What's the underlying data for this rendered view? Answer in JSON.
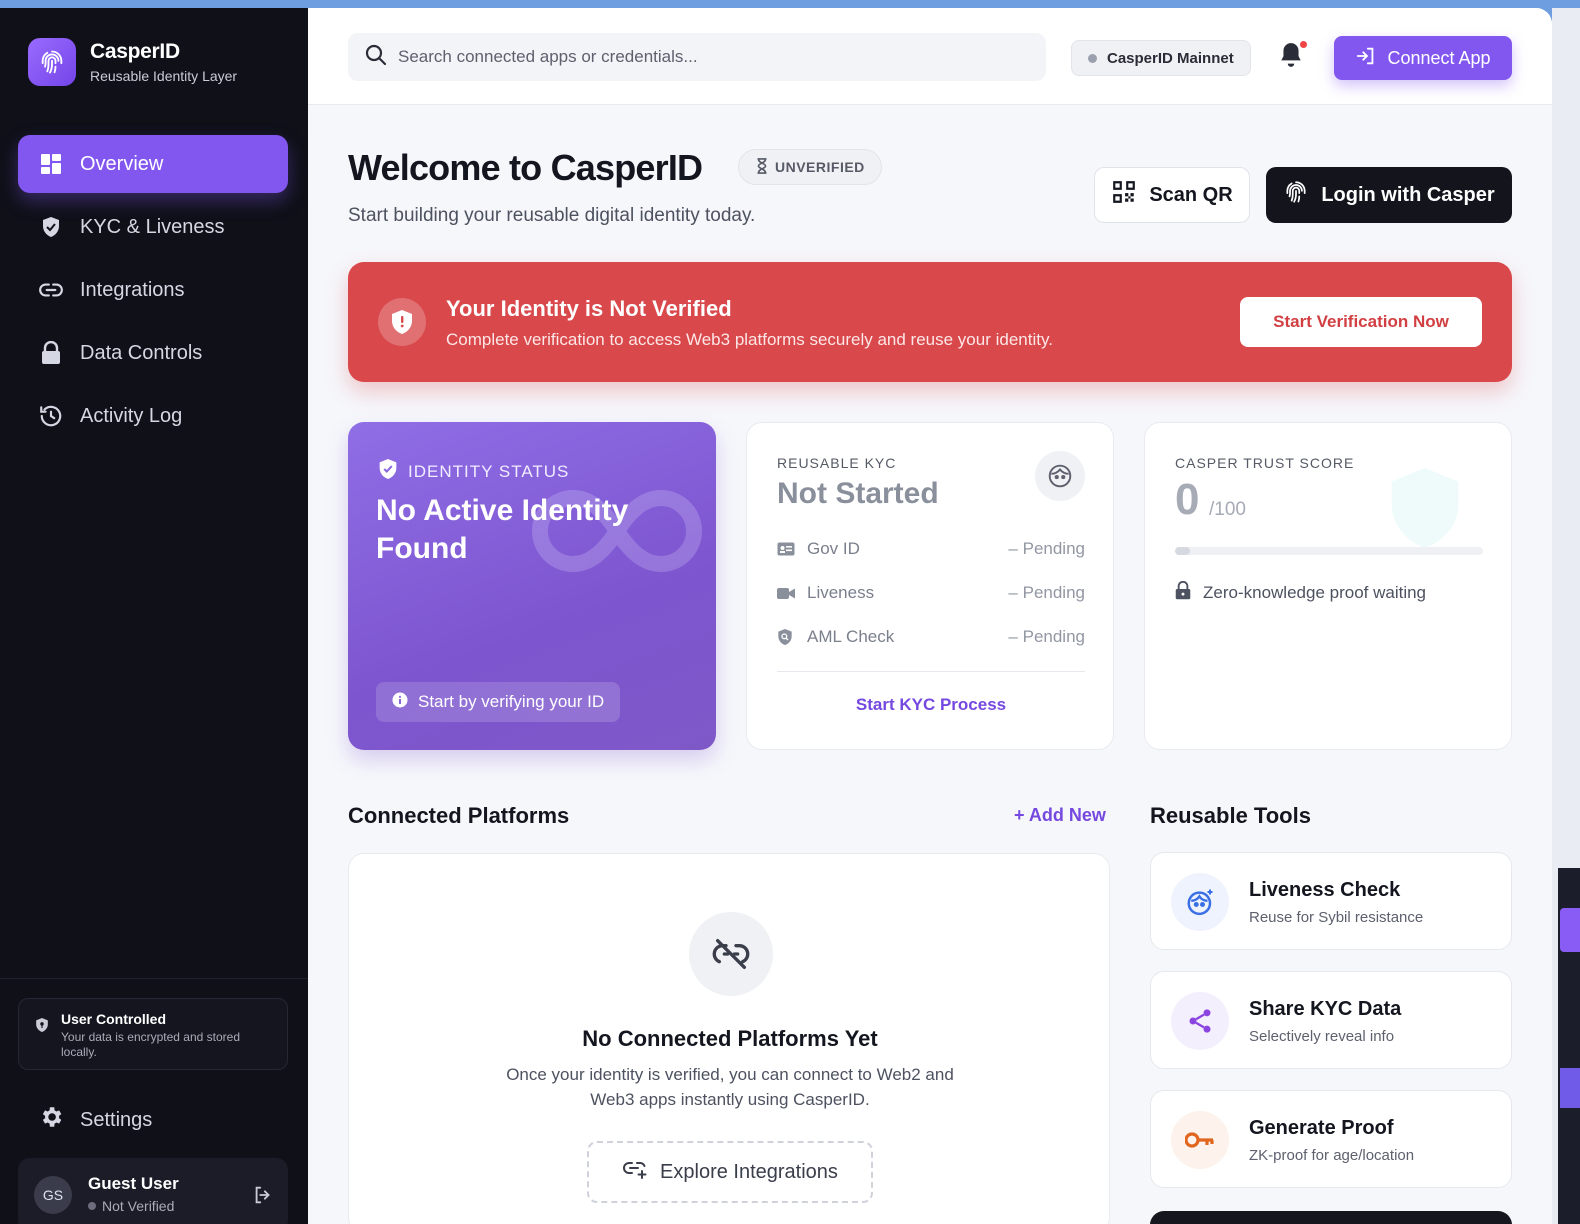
{
  "brand": {
    "name": "CasperID",
    "tagline": "Reusable Identity Layer"
  },
  "nav": [
    {
      "label": "Overview",
      "icon": "dashboard-icon",
      "active": true
    },
    {
      "label": "KYC & Liveness",
      "icon": "shield-icon",
      "active": false
    },
    {
      "label": "Integrations",
      "icon": "link-icon",
      "active": false
    },
    {
      "label": "Data Controls",
      "icon": "lock-icon",
      "active": false
    },
    {
      "label": "Activity Log",
      "icon": "history-icon",
      "active": false
    }
  ],
  "privacy": {
    "title": "User Controlled",
    "subtitle": "Your data is encrypted and stored locally."
  },
  "settings_label": "Settings",
  "user": {
    "initials": "GS",
    "name": "Guest User",
    "status": "Not Verified"
  },
  "topbar": {
    "search_placeholder": "Search connected apps or credentials...",
    "network": "CasperID Mainnet",
    "connect_label": "Connect App"
  },
  "header": {
    "title": "Welcome to CasperID",
    "badge": "UNVERIFIED",
    "subtitle": "Start building your reusable digital identity today.",
    "scan_label": "Scan QR",
    "login_label": "Login with Casper"
  },
  "alert": {
    "title": "Your Identity is Not Verified",
    "subtitle": "Complete verification to access Web3 platforms securely and reuse your identity.",
    "button": "Start Verification Now"
  },
  "identity_card": {
    "label": "IDENTITY STATUS",
    "title": "No Active Identity Found",
    "hint": "Start by verifying your ID"
  },
  "kyc_card": {
    "label": "REUSABLE KYC",
    "status": "Not Started",
    "rows": [
      {
        "label": "Gov ID",
        "value": "– Pending"
      },
      {
        "label": "Liveness",
        "value": "– Pending"
      },
      {
        "label": "AML Check",
        "value": "– Pending"
      }
    ],
    "link": "Start KYC Process"
  },
  "trust_card": {
    "label": "CASPER TRUST SCORE",
    "score": "0",
    "max": "/100",
    "progress": 0.05,
    "note": "Zero-knowledge proof waiting"
  },
  "platforms": {
    "title": "Connected Platforms",
    "add_label": "+ Add New",
    "empty_title": "No Connected Platforms Yet",
    "empty_subtitle": "Once your identity is verified, you can connect to Web2 and Web3 apps instantly using CasperID.",
    "explore_label": "Explore Integrations"
  },
  "tools": {
    "title": "Reusable Tools",
    "items": [
      {
        "title": "Liveness Check",
        "subtitle": "Reuse for Sybil resistance",
        "icon": "face-scan-icon",
        "color": "#3b6fe6",
        "bg": "#eef3fd"
      },
      {
        "title": "Share KYC Data",
        "subtitle": "Selectively reveal info",
        "icon": "share-icon",
        "color": "#8a45e0",
        "bg": "#f4effd"
      },
      {
        "title": "Generate Proof",
        "subtitle": "ZK-proof for age/location",
        "icon": "key-icon",
        "color": "#e0651e",
        "bg": "#fdf3ec"
      }
    ]
  },
  "colors": {
    "accent": "#8257f0",
    "alert": "#d9484b",
    "sidebar": "#0f1018"
  }
}
